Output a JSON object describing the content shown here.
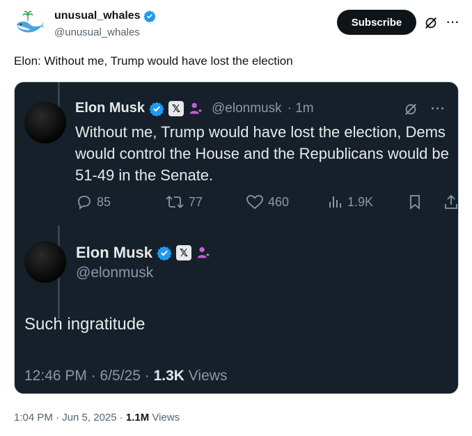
{
  "post": {
    "author_name": "unusual_whales",
    "author_handle": "@unusual_whales",
    "subscribe_label": "Subscribe",
    "more_label": "···",
    "text": "Elon: Without me, Trump would have lost the election",
    "timestamp": "1:04 PM · Jun 5, 2025 · ",
    "views_count": "1.1M",
    "views_label": " Views"
  },
  "quoted": {
    "author_name": "Elon Musk",
    "author_handle": "@elonmusk",
    "time_ago": "· 1m",
    "more_label": "···",
    "x_badge": "𝕏",
    "body": "Without me, Trump would have lost the election, Dems would control the House and the Republicans would be 51-49 in the Senate.",
    "replies": "85",
    "reposts": "77",
    "likes": "460",
    "views": "1.9K"
  },
  "reply": {
    "author_name": "Elon Musk",
    "author_handle": "@elonmusk",
    "x_badge": "𝕏",
    "text": "Such ingratitude",
    "timestamp": "12:46 PM · 6/5/25 · ",
    "views_count": "1.3K",
    "views_label": " Views"
  },
  "colors": {
    "verified": "#1d9bf0",
    "dark_bg": "#15202b",
    "accent_purple": "#c65fd6"
  },
  "icons": [
    "whale-avatar",
    "verified-badge",
    "grok-icon",
    "more-icon",
    "reply-icon",
    "repost-icon",
    "like-icon",
    "views-icon",
    "bookmark-icon",
    "share-icon",
    "x-badge-icon",
    "affiliate-icon"
  ]
}
